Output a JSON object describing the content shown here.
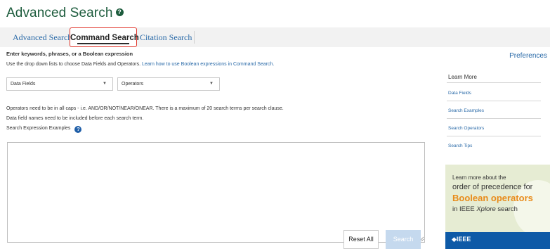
{
  "header": {
    "title": "Advanced Search",
    "help_glyph": "?"
  },
  "tabs": [
    {
      "label": "Advanced Search",
      "active": false
    },
    {
      "label": "Command Search",
      "active": true
    },
    {
      "label": "Citation Search",
      "active": false
    }
  ],
  "command_search": {
    "heading": "Enter keywords, phrases, or a Boolean expression",
    "subtext": "Use the drop down lists to choose Data Fields and Operators.",
    "subtext_link": "Learn how to use Boolean expressions in Command Search.",
    "data_fields_select": {
      "value": "Data Fields"
    },
    "operators_select": {
      "value": "Operators"
    },
    "note_1": "Operators need to be in all caps - i.e. AND/OR/NOT/NEAR/ONEAR. There is a maximum of 20 search terms per search clause.",
    "note_2": "Data field names need to be included before each search term.",
    "examples_label": "Search Expression Examples",
    "examples_icon": "?",
    "query_value": "",
    "reset_label": "Reset All",
    "search_label": "Search"
  },
  "sidebar": {
    "preferences_label": "Preferences",
    "learn_more_title": "Learn More",
    "links": [
      "Data Fields",
      "Search Examples",
      "Search Operators",
      "Search Tips"
    ]
  },
  "promo": {
    "line1": "Learn more about the",
    "line2": "order of precedence for",
    "line3": "Boolean operators",
    "line4_prefix": "in IEEE ",
    "line4_italic": "Xplore",
    "line4_suffix": " search",
    "brand": "IEEE"
  },
  "colors": {
    "title_green": "#1d5c3d",
    "link_blue": "#2a6aa8",
    "active_tab_border": "#e1362c",
    "promo_orange": "#e88b1a",
    "promo_bg": "#e6ecd3",
    "ieee_blue": "#0e5aa7"
  }
}
